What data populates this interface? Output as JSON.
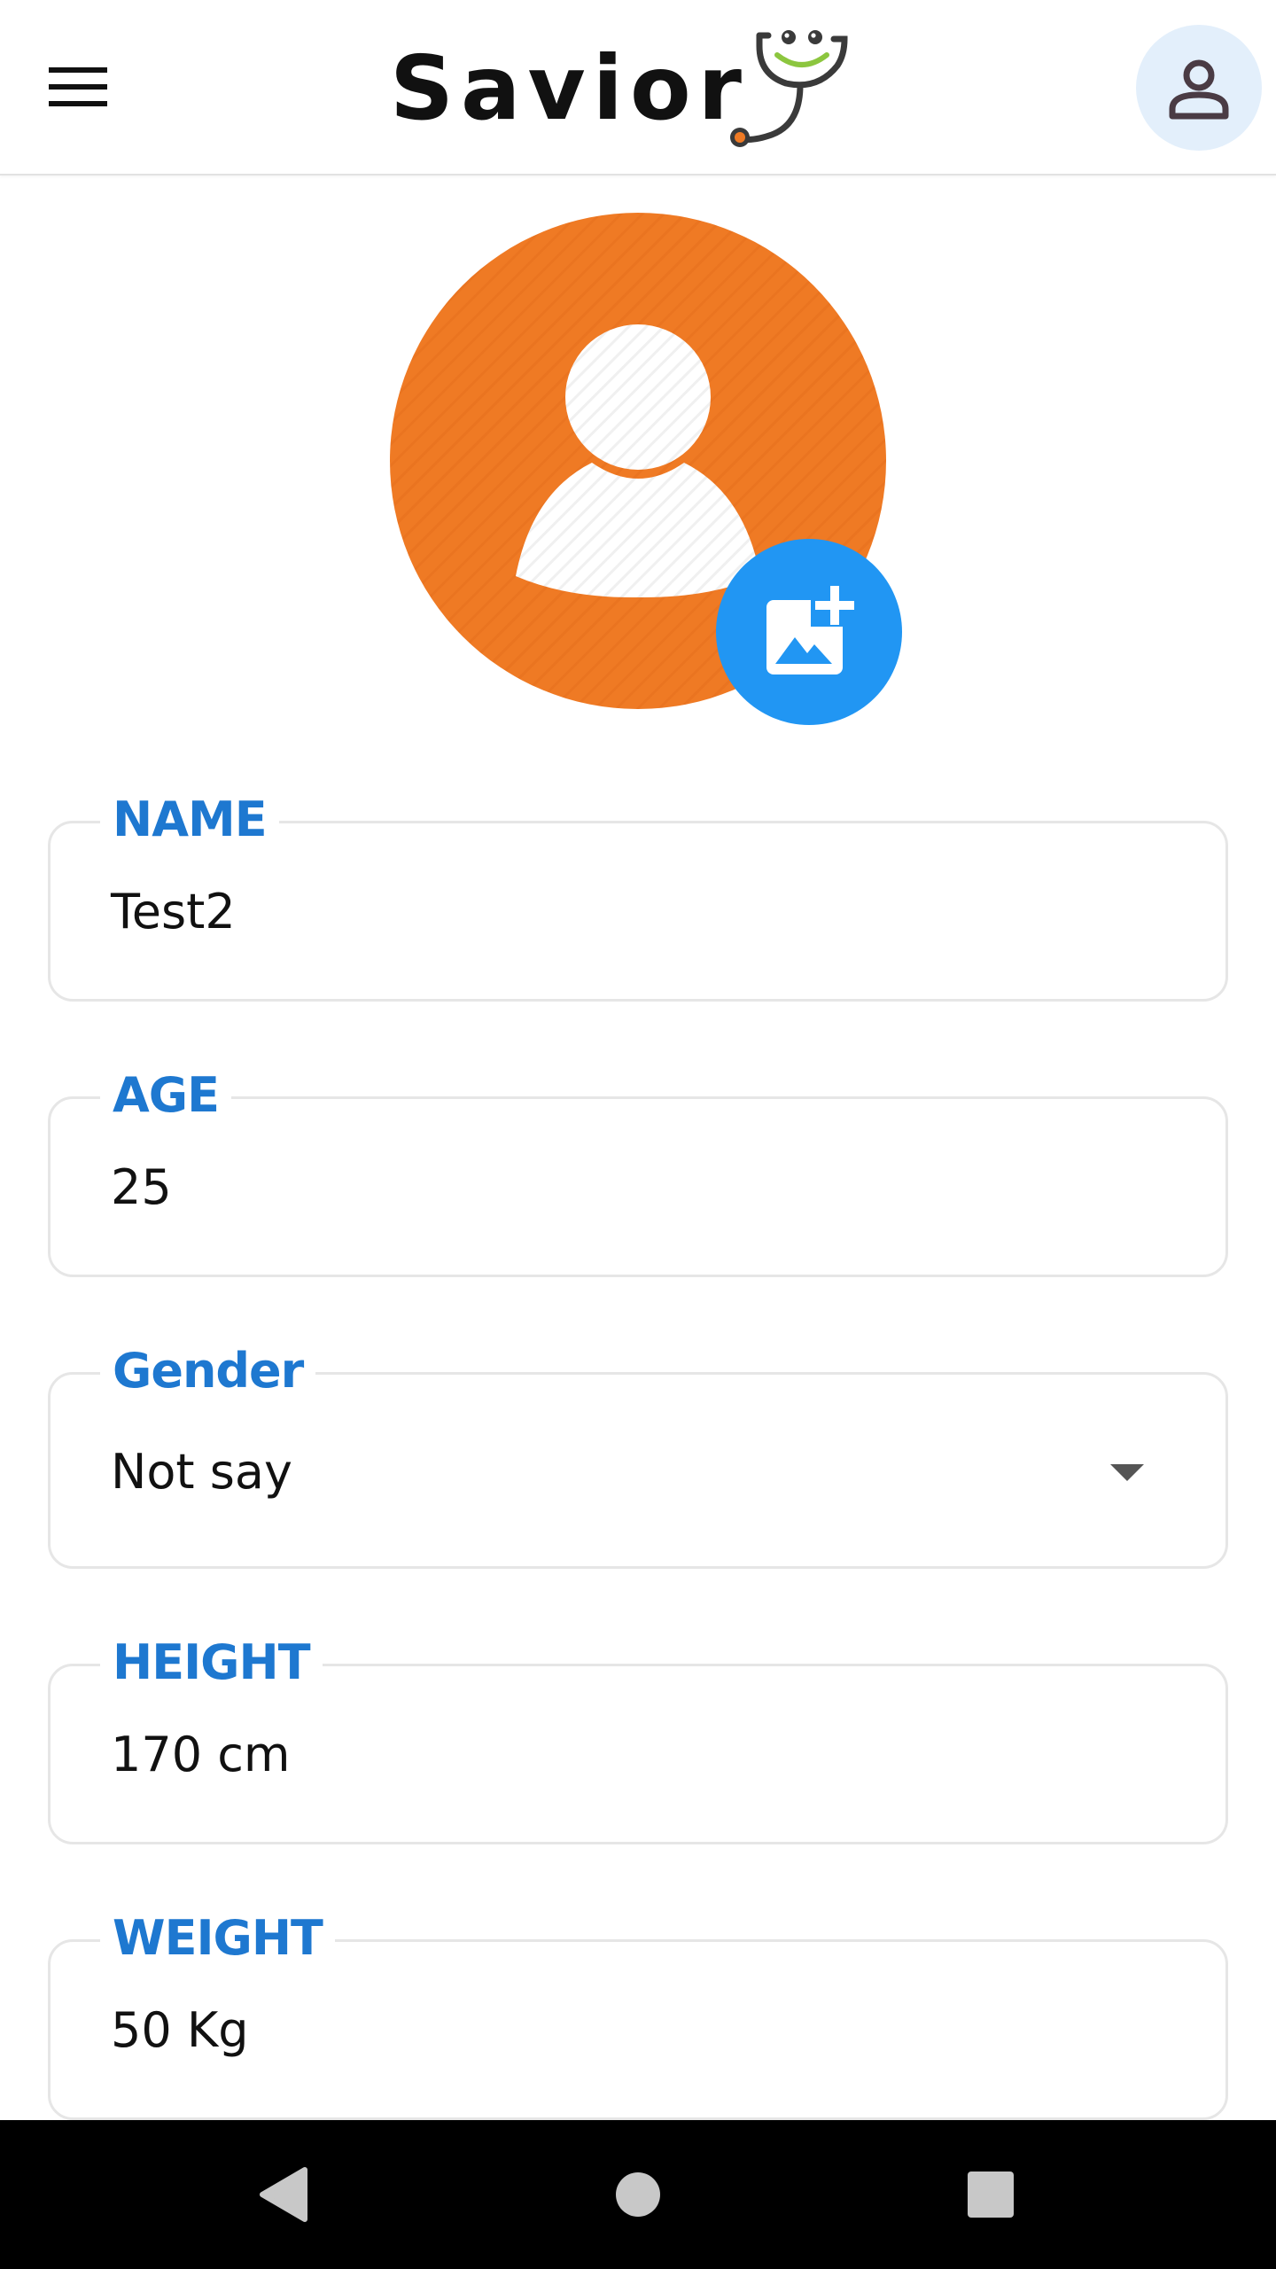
{
  "header": {
    "title": "Savior",
    "menu_icon": "hamburger-menu-icon",
    "logo_icon": "stethoscope-smile-logo",
    "profile_icon": "person-outline-icon"
  },
  "avatar": {
    "placeholder_icon": "person-silhouette-icon",
    "add_photo_icon": "add-photo-icon",
    "background_color": "#ef7a24",
    "button_color": "#2196f3"
  },
  "form": {
    "name": {
      "label": "NAME",
      "value": "Test2"
    },
    "age": {
      "label": "AGE",
      "value": "25"
    },
    "gender": {
      "label": "Gender",
      "value": "Not say"
    },
    "height": {
      "label": "HEIGHT",
      "value": "170 cm"
    },
    "weight": {
      "label": "WEIGHT",
      "value": "50 Kg"
    }
  },
  "colors": {
    "label": "#1e78d0",
    "field_border": "#e6e6e6",
    "text": "#111111"
  },
  "system_nav": {
    "back_icon": "back-triangle-icon",
    "home_icon": "home-circle-icon",
    "recents_icon": "recents-square-icon"
  }
}
